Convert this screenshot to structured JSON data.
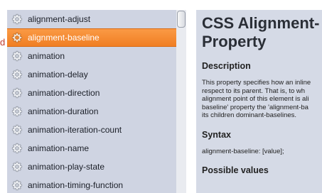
{
  "edge_fragment": "d",
  "sidebar": {
    "items": [
      {
        "label": "alignment-adjust",
        "icon": "gear-icon",
        "selected": false
      },
      {
        "label": "alignment-baseline",
        "icon": "gear-icon",
        "selected": true
      },
      {
        "label": "animation",
        "icon": "gear-icon",
        "selected": false
      },
      {
        "label": "animation-delay",
        "icon": "gear-icon",
        "selected": false
      },
      {
        "label": "animation-direction",
        "icon": "gear-icon",
        "selected": false
      },
      {
        "label": "animation-duration",
        "icon": "gear-icon",
        "selected": false
      },
      {
        "label": "animation-iteration-count",
        "icon": "gear-icon",
        "selected": false
      },
      {
        "label": "animation-name",
        "icon": "gear-icon",
        "selected": false
      },
      {
        "label": "animation-play-state",
        "icon": "gear-icon",
        "selected": false
      },
      {
        "label": "animation-timing-function",
        "icon": "gear-icon",
        "selected": false
      }
    ]
  },
  "content": {
    "title_line1": "CSS Alignment-",
    "title_line2": "Property",
    "description_heading": "Description",
    "description_lines": [
      "This property specifies how an inline",
      "respect to its parent. That is, to wh",
      "alignment point of this element is ali",
      "baseline' property the 'alignment-ba",
      "its children dominant-baselines."
    ],
    "syntax_heading": "Syntax",
    "syntax_text": "alignment-baseline: [value];",
    "possible_values_heading": "Possible values"
  },
  "colors": {
    "selected_bg": "#f58a30",
    "sidebar_bg": "#cfd4e2",
    "content_bg": "#d5dae6"
  }
}
